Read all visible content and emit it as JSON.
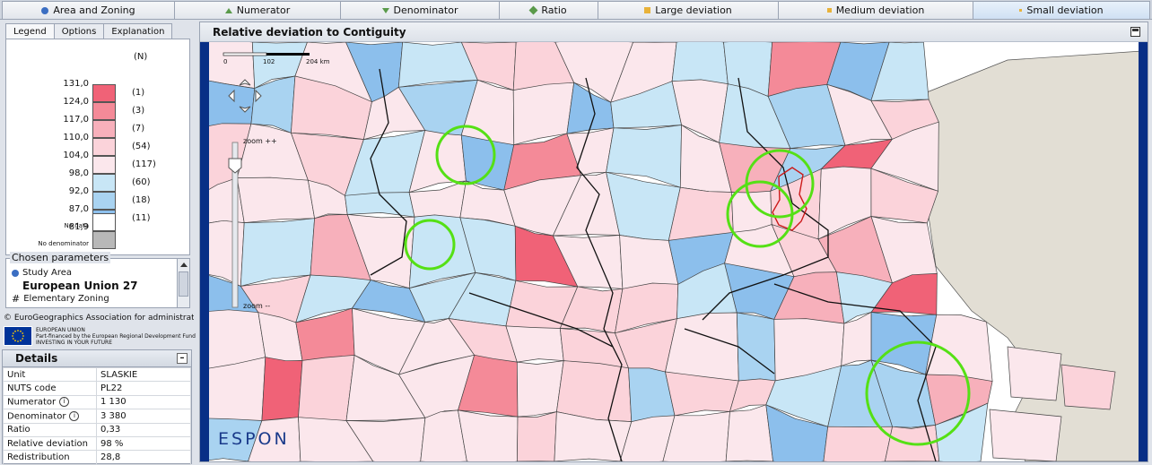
{
  "top_tabs": [
    {
      "label": "Area and Zoning",
      "icon": "blue-dot-icon"
    },
    {
      "label": "Numerator",
      "icon": "triangle-up-icon"
    },
    {
      "label": "Denominator",
      "icon": "triangle-down-icon"
    },
    {
      "label": "Ratio",
      "icon": "diamond-icon"
    },
    {
      "label": "Large deviation",
      "icon": "square-icon"
    },
    {
      "label": "Medium deviation",
      "icon": "square-small-icon"
    },
    {
      "label": "Small deviation",
      "icon": "dot-small-icon"
    }
  ],
  "left_tabs": [
    "Legend",
    "Options",
    "Explanation"
  ],
  "legend": {
    "count_header": "(N)",
    "thresholds": [
      "131,0",
      "124,0",
      "117,0",
      "110,0",
      "104,0",
      "98,0",
      "92,0",
      "87,0",
      "81,9"
    ],
    "colors": [
      "#f06277",
      "#f48a98",
      "#f7b0bb",
      "#fbd3da",
      "#fbe7ec",
      "#c8e6f6",
      "#a9d3f1",
      "#8cbfec"
    ],
    "counts": [
      "(1)",
      "(3)",
      "(7)",
      "(54)",
      "(117)",
      "(60)",
      "(18)",
      "(11)"
    ],
    "no_data": "No data",
    "no_denominator": "No denominator"
  },
  "chosen": {
    "title": "Chosen parameters",
    "study_area_label": "Study Area",
    "study_area_value": "European Union 27",
    "zoning_label": "Elementary Zoning"
  },
  "copyright": "© EuroGeographics Association  for administrati...",
  "eu_text": {
    "line1": "EUROPEAN UNION",
    "line2": "Part-financed by the European Regional Development Fund",
    "line3": "INVESTING IN YOUR FUTURE"
  },
  "details": {
    "title": "Details",
    "rows": [
      {
        "label": "Unit",
        "value": "SLASKIE"
      },
      {
        "label": "NUTS code",
        "value": "PL22"
      },
      {
        "label": "Numerator",
        "value": "1 130"
      },
      {
        "label": "Denominator",
        "value": "3 380"
      },
      {
        "label": "Ratio",
        "value": "0,33"
      },
      {
        "label": "Relative deviation",
        "value": "98 %"
      },
      {
        "label": "Redistribution",
        "value": "28,8"
      }
    ]
  },
  "map": {
    "title": "Relative deviation to Contiguity",
    "scale_labels": [
      "0",
      "102",
      "204  km"
    ],
    "zoom_in": "zoom ++",
    "zoom_out": "zoom --",
    "logo": "ESPON"
  }
}
